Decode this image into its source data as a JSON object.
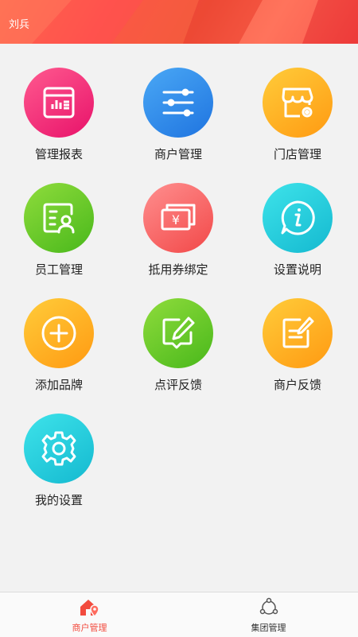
{
  "header": {
    "user_name": "刘兵",
    "accent": "#f24b3e"
  },
  "menu": [
    {
      "label": "管理报表",
      "icon": "report-icon",
      "color": "pink"
    },
    {
      "label": "商户管理",
      "icon": "sliders-icon",
      "color": "blue"
    },
    {
      "label": "门店管理",
      "icon": "store-settings-icon",
      "color": "orange"
    },
    {
      "label": "员工管理",
      "icon": "employee-card-icon",
      "color": "green"
    },
    {
      "label": "抵用券绑定",
      "icon": "voucher-icon",
      "color": "red"
    },
    {
      "label": "设置说明",
      "icon": "info-bubble-icon",
      "color": "cyan"
    },
    {
      "label": "添加品牌",
      "icon": "plus-circle-icon",
      "color": "orange"
    },
    {
      "label": "点评反馈",
      "icon": "edit-comment-icon",
      "color": "green"
    },
    {
      "label": "商户反馈",
      "icon": "edit-note-icon",
      "color": "orange"
    },
    {
      "label": "我的设置",
      "icon": "gear-icon",
      "color": "cyan"
    }
  ],
  "tabbar": {
    "tabs": [
      {
        "label": "商户管理",
        "icon": "store-location-icon",
        "active": true
      },
      {
        "label": "集团管理",
        "icon": "network-icon",
        "active": false
      }
    ]
  }
}
